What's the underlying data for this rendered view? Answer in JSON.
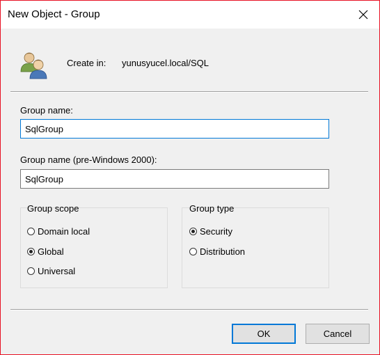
{
  "window": {
    "title": "New Object - Group"
  },
  "header": {
    "icon": "group-users-icon",
    "create_in_label": "Create in:",
    "create_in_value": "yunusyucel.local/SQL"
  },
  "fields": {
    "group_name_label": "Group name:",
    "group_name_value": "SqlGroup",
    "pre2000_label": "Group name (pre-Windows 2000):",
    "pre2000_value": "SqlGroup"
  },
  "group_scope": {
    "legend": "Group scope",
    "options": [
      {
        "label": "Domain local",
        "checked": false
      },
      {
        "label": "Global",
        "checked": true
      },
      {
        "label": "Universal",
        "checked": false
      }
    ]
  },
  "group_type": {
    "legend": "Group type",
    "options": [
      {
        "label": "Security",
        "checked": true
      },
      {
        "label": "Distribution",
        "checked": false
      }
    ]
  },
  "buttons": {
    "ok": "OK",
    "cancel": "Cancel"
  },
  "colors": {
    "window_border": "#e81123",
    "dialog_background": "#f0f0f0",
    "focus_accent": "#0078d7"
  }
}
